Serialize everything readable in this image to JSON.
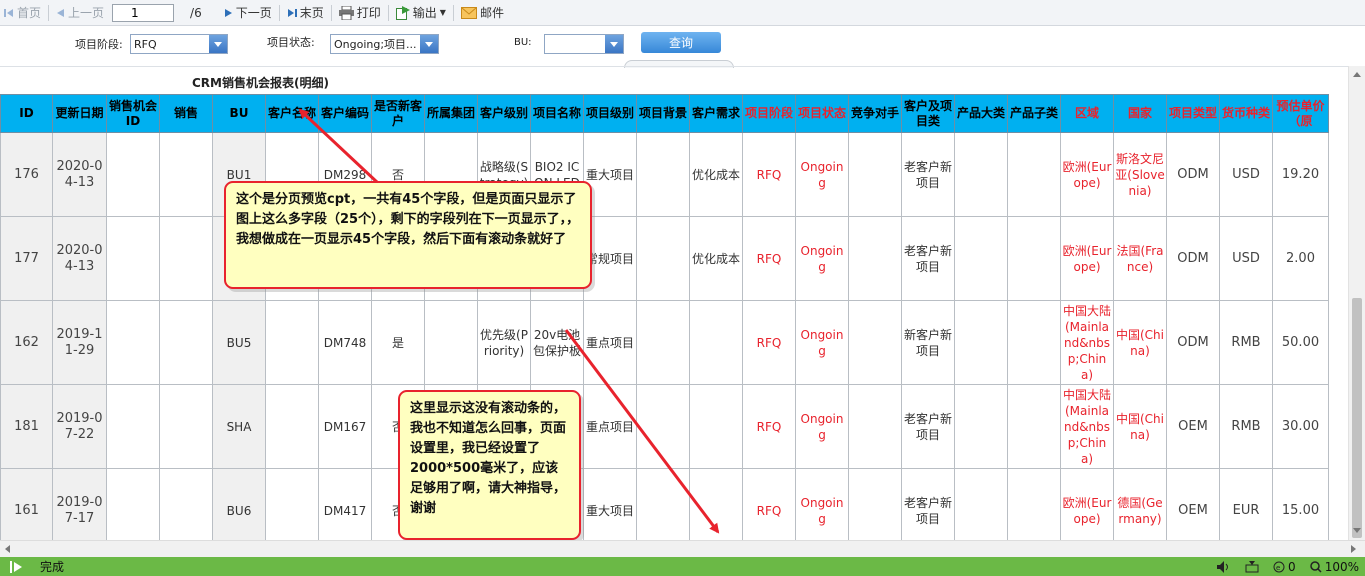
{
  "toolbar": {
    "first": "首页",
    "prev": "上一页",
    "page_value": "1",
    "page_total": "/6",
    "next": "下一页",
    "last": "末页",
    "print": "打印",
    "export": "输出",
    "mail": "邮件"
  },
  "filters": {
    "stage_label": "项目阶段:",
    "stage_value": "RFQ",
    "status_label": "项目状态:",
    "status_value": "Ongoing;项目...",
    "bu_label": "BU:",
    "bu_value": "",
    "query_label": "查询"
  },
  "report": {
    "title": "CRM销售机会报表(明细)",
    "headers": [
      "ID",
      "更新日期",
      "销售机会ID",
      "销售",
      "BU",
      "客户名称",
      "客户编码",
      "是否新客户",
      "所属集团",
      "客户级别",
      "项目名称",
      "项目级别",
      "项目背景",
      "客户需求",
      "项目阶段",
      "项目状态",
      "竞争对手",
      "客户及项目类",
      "产品大类",
      "产品子类",
      "区域",
      "国家",
      "项目类型",
      "货币种类",
      "预估单价（原"
    ],
    "rows": [
      {
        "cells": [
          "176",
          "2020-04-13",
          "",
          "",
          "BU1",
          "",
          "DM298",
          "否",
          "",
          "战略级(Strategy)",
          "BIO2 ICON LED",
          "重大项目",
          "",
          "优化成本",
          "RFQ",
          "Ongoing",
          "",
          "老客户新项目",
          "",
          "",
          "欧洲(Europe)",
          "斯洛文尼亚(Slovenia)",
          "ODM",
          "USD",
          "19.20"
        ]
      },
      {
        "cells": [
          "177",
          "2020-04-13",
          "",
          "",
          "",
          "",
          "",
          "",
          "",
          "",
          "",
          "常规项目",
          "",
          "优化成本",
          "RFQ",
          "Ongoing",
          "",
          "老客户新项目",
          "",
          "",
          "欧洲(Europe)",
          "法国(France)",
          "ODM",
          "USD",
          "2.00"
        ]
      },
      {
        "cells": [
          "162",
          "2019-11-29",
          "",
          "",
          "BU5",
          "",
          "DM748",
          "是",
          "",
          "优先级(Priority)",
          "20v电池包保护板",
          "重点项目",
          "",
          "",
          "RFQ",
          "Ongoing",
          "",
          "新客户新项目",
          "",
          "",
          "中国大陆(Mainland&nbsp;China)",
          "中国(China)",
          "ODM",
          "RMB",
          "50.00"
        ]
      },
      {
        "cells": [
          "181",
          "2019-07-22",
          "",
          "",
          "SHA",
          "",
          "DM167",
          "否",
          "",
          "",
          "",
          "重点项目",
          "",
          "",
          "RFQ",
          "Ongoing",
          "",
          "老客户新项目",
          "",
          "",
          "中国大陆(Mainland&nbsp;China)",
          "中国(China)",
          "OEM",
          "RMB",
          "30.00"
        ]
      },
      {
        "cells": [
          "161",
          "2019-07-17",
          "",
          "",
          "BU6",
          "",
          "DM417",
          "否",
          "",
          "",
          "",
          "重大项目",
          "",
          "",
          "RFQ",
          "Ongoing",
          "",
          "老客户新项目",
          "",
          "",
          "欧洲(Europe)",
          "德国(Germany)",
          "OEM",
          "EUR",
          "15.00"
        ]
      }
    ]
  },
  "callouts": {
    "top": "这个是分页预览cpt，一共有45个字段，但是页面只显示了图上这么多字段（25个），剩下的字段列在下一页显示了，，我想做成在一页显示45个字段，然后下面有滚动条就好了",
    "bottom": "这里显示这没有滚动条的，我也不知道怎么回事，页面设置里，我已经设置了2000*500毫米了，应该足够用了啊，请大神指导，谢谢"
  },
  "status": {
    "text": "完成",
    "count": "0",
    "zoom": "100%"
  },
  "colors": {
    "header_bg": "#00b0f0",
    "accent_red": "#e8232d",
    "status_green": "#6bb946",
    "callout_bg": "#ffffc0"
  }
}
